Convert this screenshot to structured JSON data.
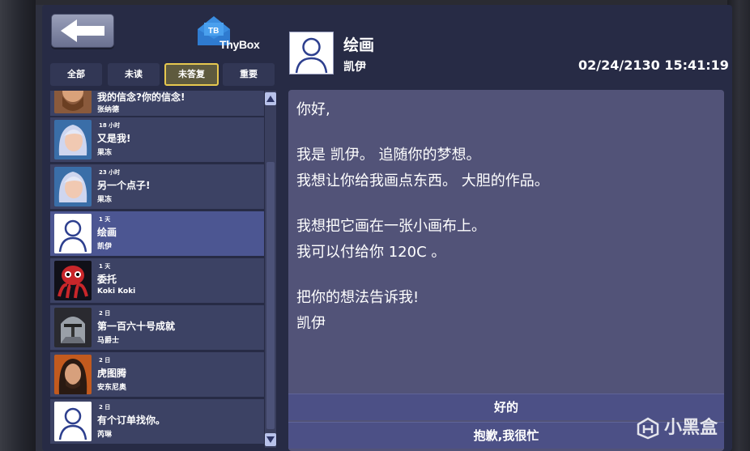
{
  "app": {
    "logo_badge": "TB",
    "logo_text": "ThyBox"
  },
  "tabs": [
    {
      "label": "全部",
      "active": false
    },
    {
      "label": "未读",
      "active": false
    },
    {
      "label": "未答复",
      "active": true
    },
    {
      "label": "重要",
      "active": false
    }
  ],
  "messages": [
    {
      "time": "",
      "subject": "我的信念?你的信念!",
      "sender": "张纳德",
      "avatar": "bearded-man-avatar"
    },
    {
      "time": "18 小时",
      "subject": "又是我!",
      "sender": "果冻",
      "avatar": "silver-hair-girl-avatar"
    },
    {
      "time": "23 小时",
      "subject": "另一个点子!",
      "sender": "果冻",
      "avatar": "silver-hair-girl-avatar"
    },
    {
      "time": "1 天",
      "subject": "绘画",
      "sender": "凯伊",
      "avatar": "default-user-avatar",
      "selected": true
    },
    {
      "time": "1 天",
      "subject": "委托",
      "sender": "Koki Koki",
      "avatar": "red-octopus-avatar"
    },
    {
      "time": "2 日",
      "subject": "第一百六十号成就",
      "sender": "马爵士",
      "avatar": "knight-helmet-avatar"
    },
    {
      "time": "2 日",
      "subject": "虎图腾",
      "sender": "安东尼奥",
      "avatar": "long-hair-man-avatar"
    },
    {
      "time": "2 日",
      "subject": "有个订单找你。",
      "sender": "芮琳",
      "avatar": "default-user-avatar"
    }
  ],
  "email": {
    "subject": "绘画",
    "sender": "凯伊",
    "datetime": "02/24/2130 15:41:19",
    "body": {
      "l1": "你好,",
      "l2": "我是 凯伊。 追随你的梦想。",
      "l3": "我想让你给我画点东西。 大胆的作品。",
      "l4": "我想把它画在一张小画布上。",
      "l5": "我可以付给你 120C 。",
      "l6": "把你的想法告诉我!",
      "l7": "凯伊"
    }
  },
  "replies": {
    "accept": "好的",
    "decline": "抱歉,我很忙"
  },
  "watermark": {
    "text": "小黑盒"
  },
  "colors": {
    "panel": "#272b45",
    "selected_item": "#4c5692",
    "active_tab_border": "#e6c84f",
    "body_panel": "#525378"
  }
}
